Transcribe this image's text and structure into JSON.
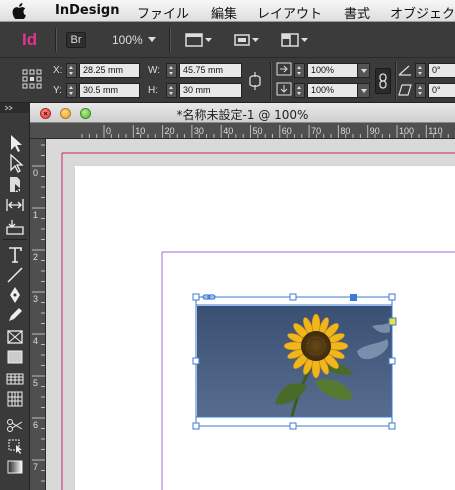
{
  "menubar": {
    "app_name": "InDesign",
    "items": [
      "ファイル",
      "編集",
      "レイアウト",
      "書式",
      "オブジェク"
    ]
  },
  "appbar": {
    "logo": "Id",
    "bridge": "Br",
    "zoom": "100%"
  },
  "control": {
    "x_label": "X:",
    "x_value": "28.25 mm",
    "y_label": "Y:",
    "y_value": "30.5 mm",
    "w_label": "W:",
    "w_value": "45.75 mm",
    "h_label": "H:",
    "h_value": "30 mm",
    "scale_x": "100%",
    "scale_y": "100%",
    "angle": "0°",
    "shear": "0°"
  },
  "document": {
    "title": "*名称未設定-1 @ 100%",
    "ruler_top": [
      "0",
      "10",
      "20",
      "30",
      "40",
      "50",
      "60",
      "70",
      "80",
      "90",
      "100",
      "110"
    ],
    "ruler_left": [
      "0",
      "1",
      "2",
      "3",
      "4",
      "5",
      "6",
      "7"
    ]
  },
  "colors": {
    "margin_guide": "#d0206e",
    "column_guide": "#9d6be0",
    "selection": "#3a7bd5",
    "sky": "#40577a",
    "petal": "#f2b61d"
  }
}
